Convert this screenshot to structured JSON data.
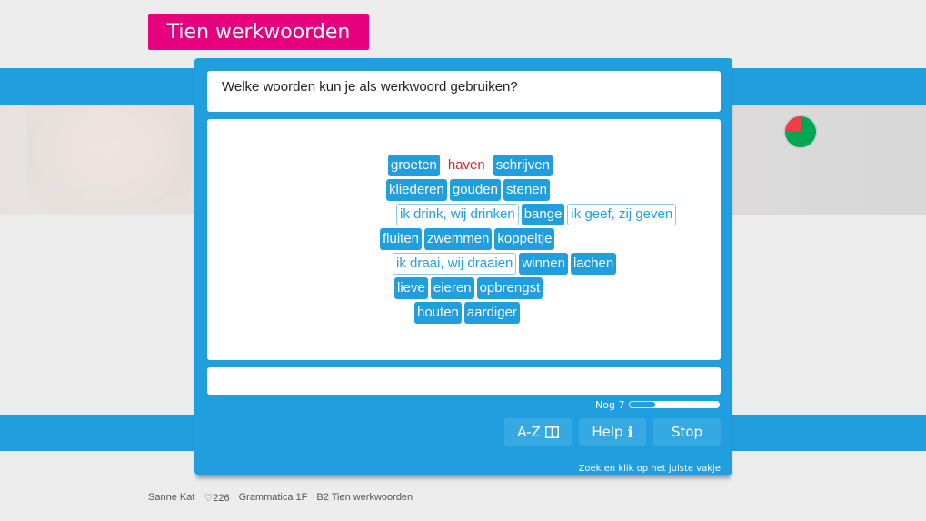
{
  "header": {
    "title": "Tien werkwoorden"
  },
  "exercise": {
    "question": "Welke woorden kun je als werkwoord gebruiken?",
    "rows": [
      [
        {
          "label": "groeten",
          "state": "normal"
        },
        {
          "label": "haven",
          "state": "wrong"
        },
        {
          "label": "schrijven",
          "state": "normal"
        }
      ],
      [
        {
          "label": "kliederen",
          "state": "normal"
        },
        {
          "label": "gouden",
          "state": "normal"
        },
        {
          "label": "stenen",
          "state": "normal"
        }
      ],
      [
        {
          "label": "ik drink, wij drinken",
          "state": "correct"
        },
        {
          "label": "bange",
          "state": "normal"
        },
        {
          "label": "ik geef, zij geven",
          "state": "correct"
        }
      ],
      [
        {
          "label": "fluiten",
          "state": "normal"
        },
        {
          "label": "zwemmen",
          "state": "normal"
        },
        {
          "label": "koppeltje",
          "state": "normal"
        }
      ],
      [
        {
          "label": "ik draai, wij draaien",
          "state": "correct"
        },
        {
          "label": "winnen",
          "state": "normal"
        },
        {
          "label": "lachen",
          "state": "normal"
        }
      ],
      [
        {
          "label": "lieve",
          "state": "normal"
        },
        {
          "label": "eieren",
          "state": "normal"
        },
        {
          "label": "opbrengst",
          "state": "normal"
        }
      ],
      [
        {
          "label": "houten",
          "state": "normal"
        },
        {
          "label": "aardiger",
          "state": "normal"
        }
      ]
    ],
    "answer_value": ""
  },
  "progress": {
    "label": "Nog 7",
    "remaining": 7,
    "total": 10,
    "fraction_done": 0.3
  },
  "score": {
    "correct_fraction": 0.75,
    "wrong_fraction": 0.25,
    "correct_color": "#00a651",
    "wrong_color": "#ef3e4a"
  },
  "toolbar": {
    "az_label": "A-Z",
    "help_label": "Help",
    "stop_label": "Stop",
    "book_icon": "book-icon",
    "info_icon": "info-icon"
  },
  "hint": "Zoek en klik op het juiste vakje",
  "footer": {
    "user": "Sanne Kat",
    "hearts": "♡226",
    "course": "Grammatica 1F",
    "lesson": "B2 Tien werkwoorden"
  },
  "colors": {
    "accent": "#219ede",
    "brand_pink": "#e6007e",
    "wrong_text": "#e0202a"
  }
}
